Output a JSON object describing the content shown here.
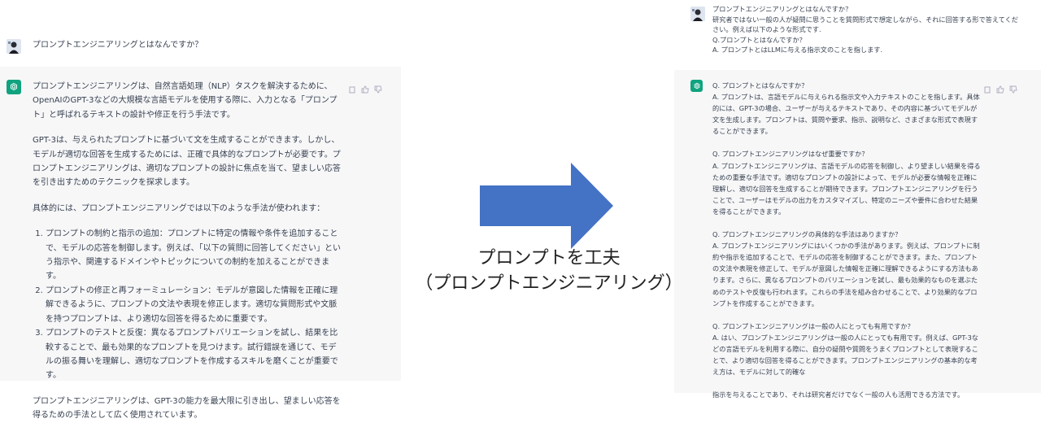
{
  "left": {
    "question": "プロンプトエンジニアリングとはなんですか？",
    "answer_paragraphs": [
      "プロンプトエンジニアリングは、自然言語処理（NLP）タスクを解決するために、OpenAIのGPT-3などの大規模な言語モデルを使用する際に、入力となる「プロンプト」と呼ばれるテキストの設計や修正を行う手法です。",
      "GPT-3は、与えられたプロンプトに基づいて文を生成することができます。しかし、モデルが適切な回答を生成するためには、正確で具体的なプロンプトが必要です。プロンプトエンジニアリングは、適切なプロンプトの設計に焦点を当て、望ましい応答を引き出すためのテクニックを探求します。",
      "具体的には、プロンプトエンジニアリングでは以下のような手法が使われます："
    ],
    "answer_list": [
      "プロンプトの制約と指示の追加：プロンプトに特定の情報や条件を追加することで、モデルの応答を制御します。例えば、「以下の質問に回答してください」という指示や、関連するドメインやトピックについての制約を加えることができます。",
      "プロンプトの修正と再フォーミュレーション：モデルが意図した情報を正確に理解できるように、プロンプトの文法や表現を修正します。適切な質問形式や文脈を持つプロンプトは、より適切な回答を得るために重要です。",
      "プロンプトのテストと反復：異なるプロンプトバリエーションを試し、結果を比較することで、最も効果的なプロンプトを見つけます。試行錯誤を通じて、モデルの振る舞いを理解し、適切なプロンプトを作成するスキルを磨くことが重要です。"
    ],
    "answer_closing": "プロンプトエンジニアリングは、GPT-3の能力を最大限に引き出し、望ましい応答を得るための手法として広く使用されています。"
  },
  "right": {
    "question_lines": [
      "プロンプトエンジニアリングとはなんですか？",
      "研究者ではない一般の人が疑問に思うことを質問形式で想定しながら、それに回答する形で答えてください。例えば以下のような形式です.",
      "Q.プロンプトとはなんですか？",
      "A. プロンプトとはLLMに与える指示文のことを指します."
    ],
    "qa": [
      {
        "q": "Q. プロンプトとはなんですか？",
        "a": "A. プロンプトは、言語モデルに与えられる指示文や入力テキストのことを指します。具体的には、GPT-3の場合、ユーザーが与えるテキストであり、その内容に基づいてモデルが文を生成します。プロンプトは、質問や要求、指示、説明など、さまざまな形式で表現することができます。"
      },
      {
        "q": "Q. プロンプトエンジニアリングはなぜ重要ですか？",
        "a": "A. プロンプトエンジニアリングは、言語モデルの応答を制御し、より望ましい結果を得るための重要な手法です。適切なプロンプトの設計によって、モデルが必要な情報を正確に理解し、適切な回答を生成することが期待できます。プロンプトエンジニアリングを行うことで、ユーザーはモデルの出力をカスタマイズし、特定のニーズや要件に合わせた結果を得ることができます。"
      },
      {
        "q": "Q. プロンプトエンジニアリングの具体的な手法はありますか？",
        "a": "A. プロンプトエンジニアリングにはいくつかの手法があります。例えば、プロンプトに制約や指示を追加することで、モデルの応答を制御することができます。また、プロンプトの文法や表現を修正して、モデルが意図した情報を正確に理解できるようにする方法もあります。さらに、異なるプロンプトのバリエーションを試し、最も効果的なものを選ぶためのテストや反復も行われます。これらの手法を組み合わせることで、より効果的なプロンプトを作成することができます。"
      },
      {
        "q": "Q. プロンプトエンジニアリングは一般の人にとっても有用ですか？",
        "a": "A. はい、プロンプトエンジニアリングは一般の人にとっても有用です。例えば、GPT-3などの言語モデルを利用する際に、自分の疑問や質問をうまくプロンプトとして表現することで、より適切な回答を得ることができます。プロンプトエンジニアリングの基本的な考え方は、モデルに対して的確な"
      }
    ],
    "tail": "指示を与えることであり、それは研究者だけでなく一般の人も活用できる方法です。"
  },
  "caption": {
    "line1": "プロンプトを工夫",
    "line2": "（プロンプトエンジニアリング）"
  },
  "colors": {
    "arrow": "#4472c4",
    "ai_bg": "#f7f7f8",
    "chatgpt_green": "#10a37f",
    "icon_grey": "#acacbe"
  },
  "icons": [
    "user-avatar-icon",
    "chatgpt-logo-icon",
    "copy-icon",
    "thumbs-up-icon",
    "thumbs-down-icon",
    "right-arrow-icon"
  ]
}
